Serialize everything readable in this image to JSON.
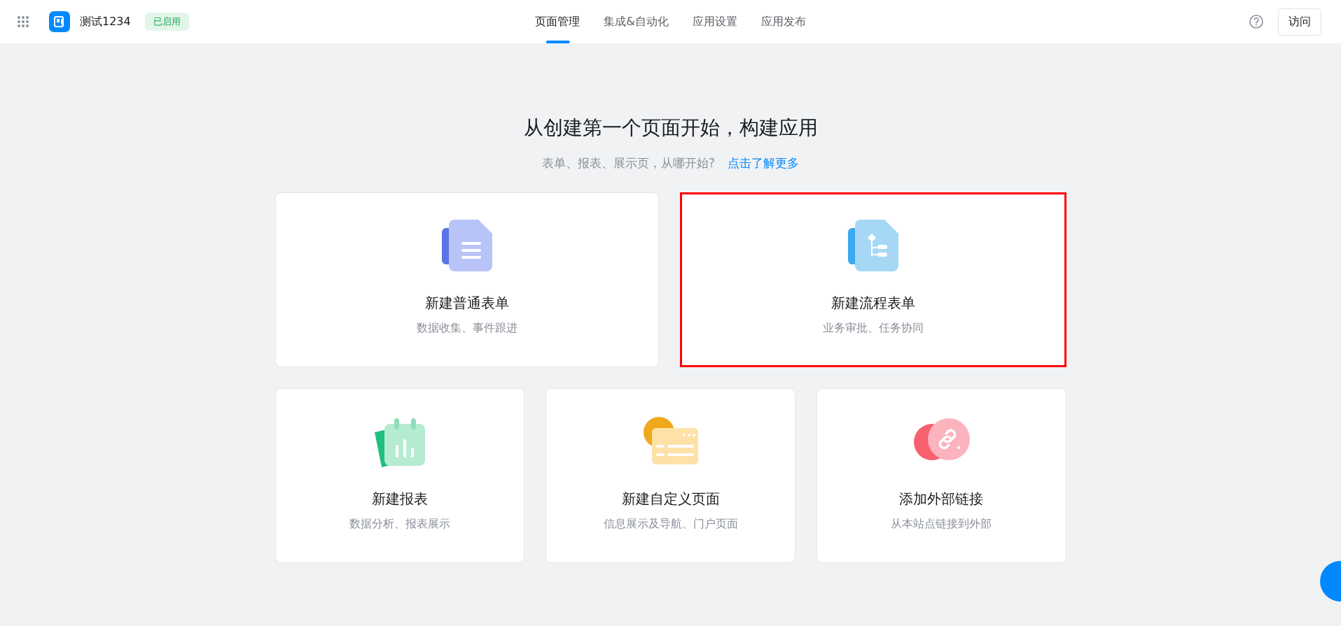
{
  "header": {
    "app_name": "测试1234",
    "status_badge": "已启用",
    "tabs": [
      {
        "label": "页面管理",
        "selected": true
      },
      {
        "label": "集成&自动化",
        "selected": false
      },
      {
        "label": "应用设置",
        "selected": false
      },
      {
        "label": "应用发布",
        "selected": false
      }
    ],
    "visit_button": "访问"
  },
  "heading": "从创建第一个页面开始，构建应用",
  "subtitle": "表单、报表、展示页，从哪开始?",
  "learn_more_link": "点击了解更多",
  "cards": [
    {
      "kind": "form",
      "title": "新建普通表单",
      "description": "数据收集、事件跟进",
      "highlighted": false
    },
    {
      "kind": "flow",
      "title": "新建流程表单",
      "description": "业务审批、任务协同",
      "highlighted": true
    },
    {
      "kind": "report",
      "title": "新建报表",
      "description": "数据分析、报表展示",
      "highlighted": false
    },
    {
      "kind": "custom",
      "title": "新建自定义页面",
      "description": "信息展示及导航、门户页面",
      "highlighted": false
    },
    {
      "kind": "link",
      "title": "添加外部链接",
      "description": "从本站点链接到外部",
      "highlighted": false
    }
  ]
}
